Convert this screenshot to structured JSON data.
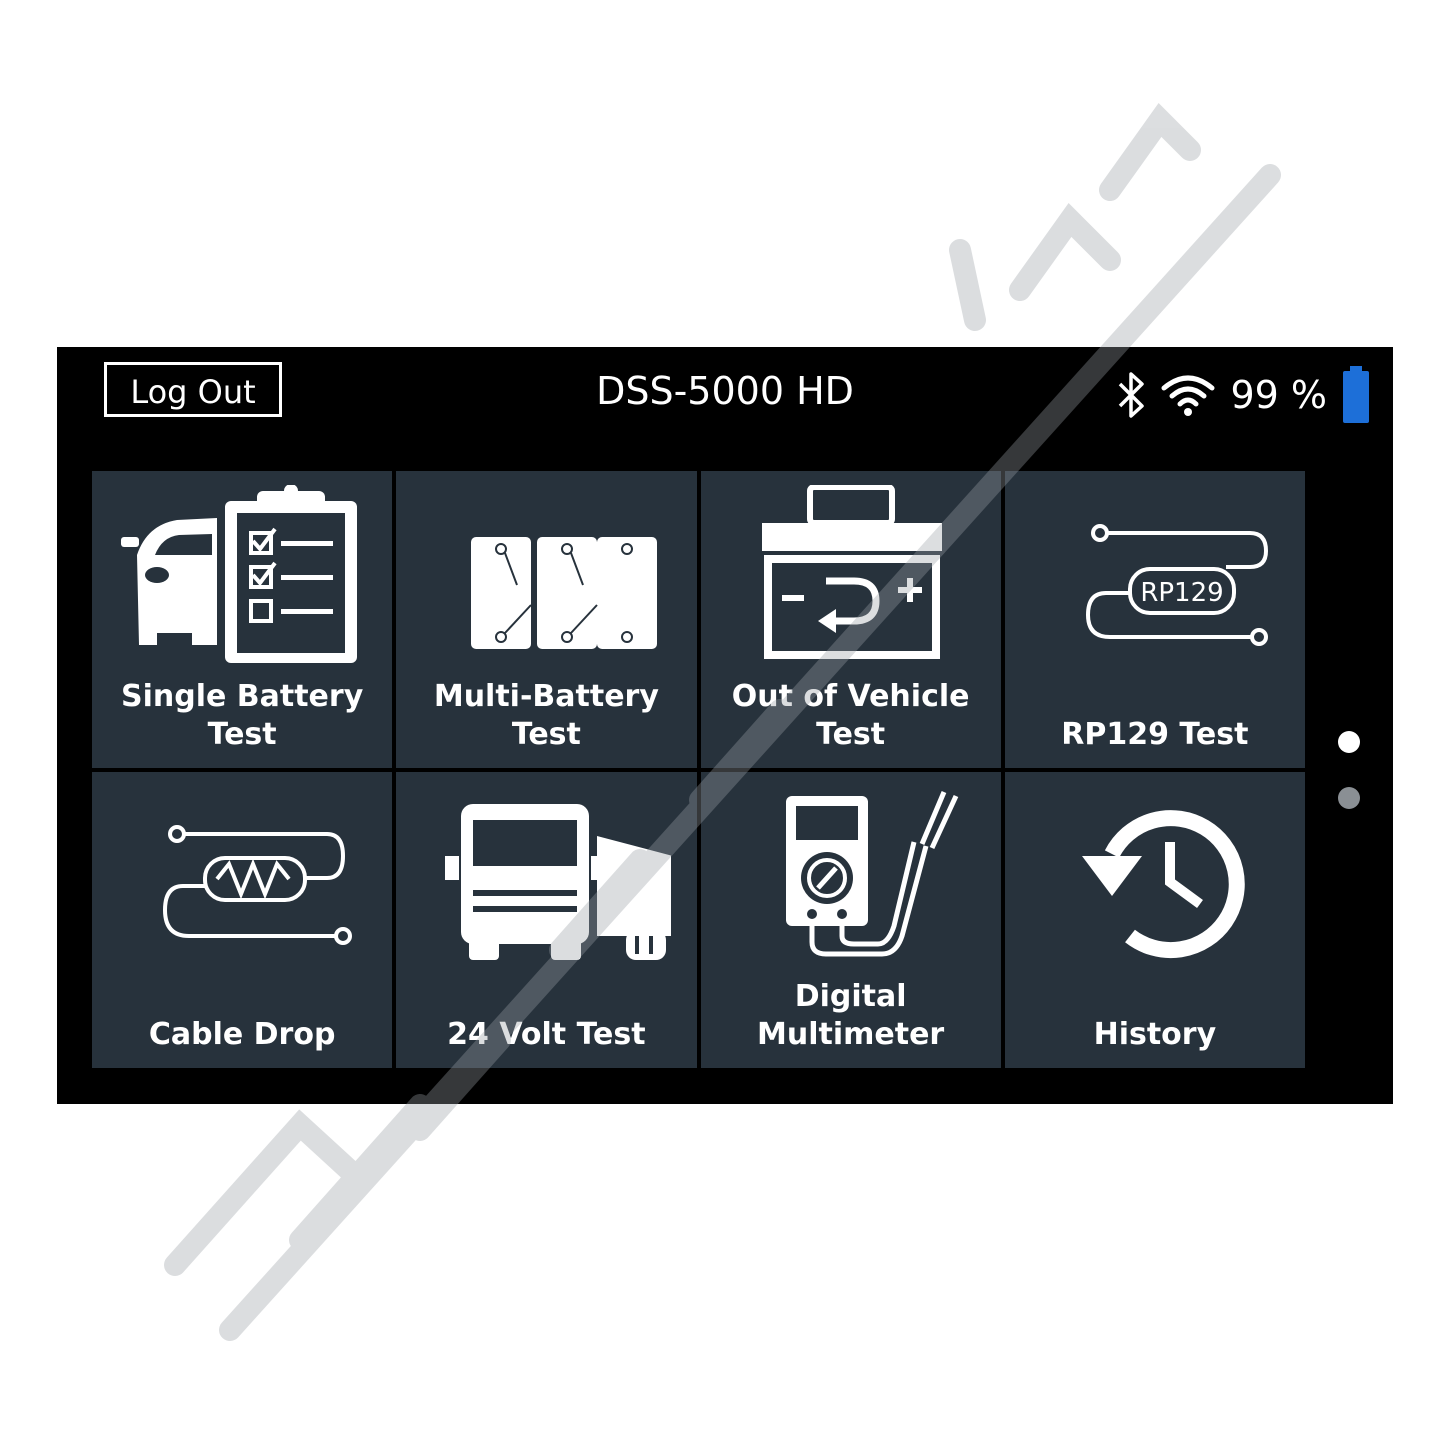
{
  "header": {
    "logout_label": "Log Out",
    "title": "DSS-5000 HD",
    "battery_percent": "99 %",
    "battery_level": 0.99,
    "icons": [
      "bluetooth-icon",
      "wifi-icon",
      "battery-icon"
    ]
  },
  "tiles": [
    {
      "label": "Single Battery\nTest",
      "icon": "car-checklist-icon"
    },
    {
      "label": "Multi-Battery Test",
      "icon": "multi-battery-icon"
    },
    {
      "label": "Out of Vehicle\nTest",
      "icon": "battery-icon"
    },
    {
      "label": "RP129 Test",
      "icon": "rp129-cable-icon",
      "icon_text": "RP129"
    },
    {
      "label": "Cable Drop",
      "icon": "cable-resistor-icon"
    },
    {
      "label": "24 Volt Test",
      "icon": "truck-icon"
    },
    {
      "label": "Digital\nMultimeter",
      "icon": "multimeter-icon"
    },
    {
      "label": "History",
      "icon": "history-icon"
    }
  ],
  "pager": {
    "pages": 2,
    "current": 1
  },
  "colors": {
    "screen_bg": "#000000",
    "tile_bg": "#27323c",
    "battery_fill": "#1d6fd8",
    "text": "#ffffff"
  }
}
